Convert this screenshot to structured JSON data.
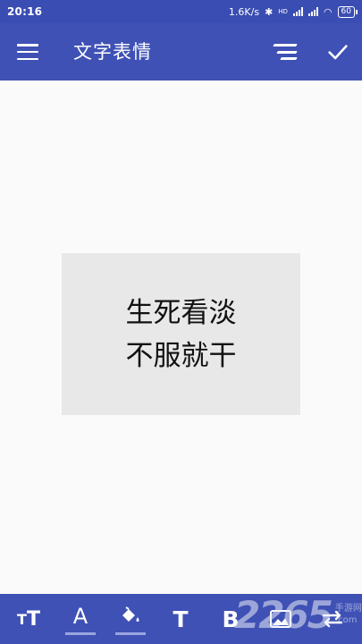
{
  "status_bar": {
    "time": "20:16",
    "net_speed": "1.6K/s",
    "network_badge": "HD",
    "battery": "60"
  },
  "app_bar": {
    "title": "文字表情",
    "icons": {
      "menu": "menu-icon",
      "align": "text-align-icon",
      "confirm": "check-icon"
    }
  },
  "sticker": {
    "lines": [
      "生死看淡",
      "不服就干"
    ],
    "background": "#e8e8e8",
    "text_color": "#111111"
  },
  "toolbar": {
    "tools": [
      {
        "id": "text-size",
        "icon": "text-size-icon"
      },
      {
        "id": "text-color",
        "icon": "text-color-icon",
        "glyph": "A"
      },
      {
        "id": "fill-color",
        "icon": "fill-bucket-icon"
      },
      {
        "id": "font",
        "icon": "font-icon",
        "glyph": "T"
      },
      {
        "id": "bold",
        "icon": "bold-icon",
        "glyph": "B"
      },
      {
        "id": "image",
        "icon": "image-icon"
      },
      {
        "id": "swap",
        "icon": "swap-icon"
      }
    ]
  },
  "watermark": {
    "logo": "2265",
    "site_line1": "手游网",
    "site_line2": ".com"
  },
  "colors": {
    "primary": "#3f51b5",
    "status_bar": "#3a4db2",
    "canvas": "#fafafa"
  }
}
